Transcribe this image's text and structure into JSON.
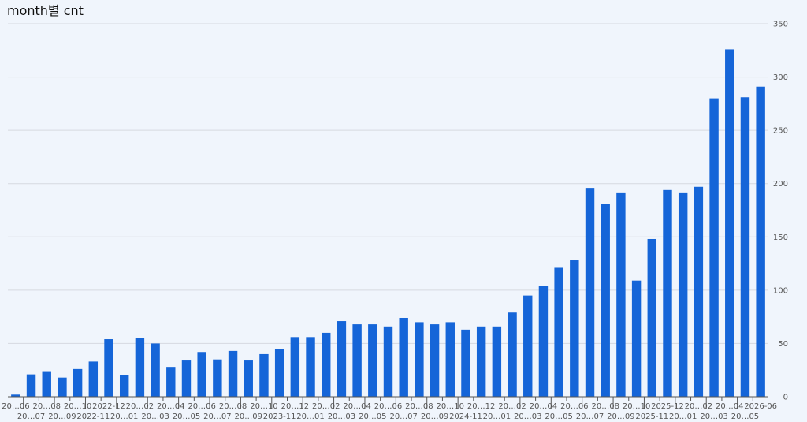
{
  "chart_data": {
    "type": "bar",
    "title": "month별 cnt",
    "xlabel": "",
    "ylabel": "",
    "ylim": [
      0,
      350
    ],
    "y_ticks": [
      0,
      50,
      100,
      150,
      200,
      250,
      300,
      350
    ],
    "y_axis_position": "right",
    "grid": true,
    "bar_color": "#1565d8",
    "categories": [
      "2022-06",
      "2022-07",
      "2022-08",
      "2022-09",
      "2022-10",
      "2022-11",
      "2022-12",
      "2023-01",
      "2023-02",
      "2023-03",
      "2023-04",
      "2023-05",
      "2023-06",
      "2023-07",
      "2023-08",
      "2023-09",
      "2023-10",
      "2023-11",
      "2023-12",
      "2024-01",
      "2024-02",
      "2024-03",
      "2024-04",
      "2024-05",
      "2024-06",
      "2024-07",
      "2024-08",
      "2024-09",
      "2024-10",
      "2024-11",
      "2024-12",
      "2025-01",
      "2025-02",
      "2025-03",
      "2025-04",
      "2025-05",
      "2025-06",
      "2025-07",
      "2025-08",
      "2025-09",
      "2025-10",
      "2025-11",
      "2025-12",
      "2026-01",
      "2026-02",
      "2026-03",
      "2026-04",
      "2026-05",
      "2026-06"
    ],
    "tick_labels": [
      "20…06",
      "20…07",
      "20…08",
      "20…09",
      "20…10",
      "2022-11",
      "2022-12",
      "20…01",
      "20…02",
      "20…03",
      "20…04",
      "20…05",
      "20…06",
      "20…07",
      "20…08",
      "20…09",
      "20…10",
      "2023-11",
      "20…12",
      "20…01",
      "20…02",
      "20…03",
      "20…04",
      "20…05",
      "20…06",
      "20…07",
      "20…08",
      "20…09",
      "20…10",
      "2024-11",
      "20…12",
      "20…01",
      "20…02",
      "20…03",
      "20…04",
      "20…05",
      "20…06",
      "20…07",
      "20…08",
      "20…09",
      "20…10",
      "2025-11",
      "2025-12",
      "20…01",
      "20…02",
      "20…03",
      "20…04",
      "20…05",
      "2026-06"
    ],
    "values": [
      2,
      21,
      24,
      18,
      26,
      33,
      54,
      20,
      55,
      50,
      28,
      34,
      42,
      35,
      43,
      34,
      40,
      45,
      56,
      56,
      60,
      71,
      68,
      68,
      66,
      74,
      70,
      68,
      70,
      63,
      66,
      66,
      79,
      95,
      104,
      121,
      128,
      196,
      181,
      191,
      109,
      148,
      194,
      191,
      197,
      280,
      326,
      281,
      291
    ]
  }
}
